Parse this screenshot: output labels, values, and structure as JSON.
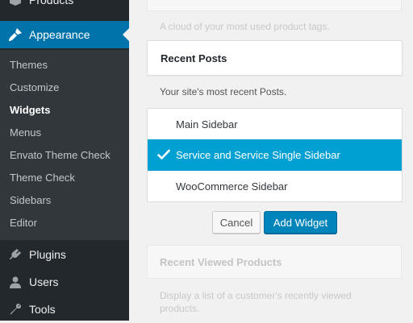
{
  "sidebar": {
    "products_label": "Products",
    "appearance_label": "Appearance",
    "submenu": [
      "Themes",
      "Customize",
      "Widgets",
      "Menus",
      "Envato Theme Check",
      "Theme Check",
      "Sidebars",
      "Editor"
    ],
    "plugins_label": "Plugins",
    "users_label": "Users",
    "tools_label": "Tools"
  },
  "main": {
    "tag_cloud_desc": "A cloud of your most used product tags.",
    "widget_title": "Recent Posts",
    "widget_desc": "Your site's most recent Posts.",
    "sidebars": [
      "Main Sidebar",
      "Service and Service Single Sidebar",
      "WooCommerce Sidebar"
    ],
    "selected_sidebar": "Service and Service Single Sidebar",
    "cancel_label": "Cancel",
    "add_label": "Add Widget",
    "next_widget_title": "Recent Viewed Products",
    "next_widget_desc_line1": "Display a list of a customer's recently viewed",
    "next_widget_desc_line2": "products."
  },
  "colors": {
    "sidebar_bg": "#23282d",
    "submenu_bg": "#32373c",
    "accent": "#0073aa",
    "selected_bg": "#00a0d2",
    "primary_button": "#0085ba"
  }
}
